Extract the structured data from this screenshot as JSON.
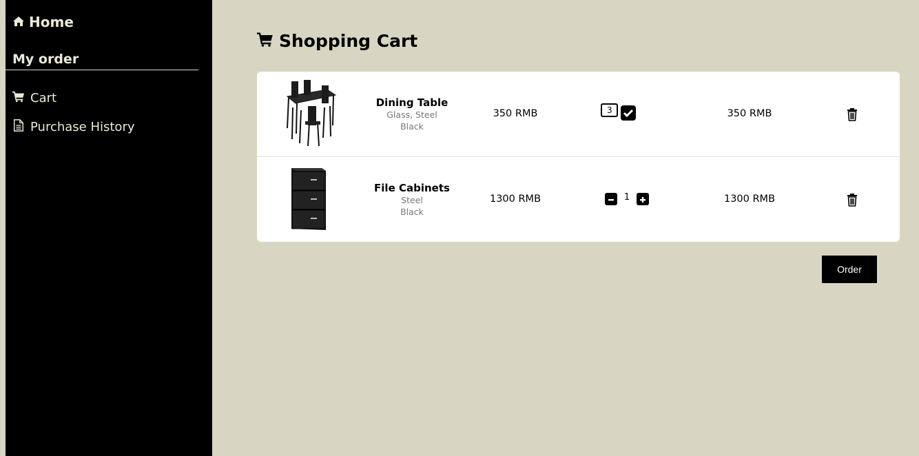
{
  "sidebar": {
    "home_label": "Home",
    "section_label": "My order",
    "items": [
      {
        "label": "Cart",
        "icon": "cart-icon"
      },
      {
        "label": "Purchase History",
        "icon": "document-icon"
      }
    ]
  },
  "main": {
    "title": "Shopping Cart",
    "title_icon": "cart-icon",
    "cart_items": [
      {
        "name": "Dining Table",
        "material": "Glass, Steel",
        "color": "Black",
        "price": "350 RMB",
        "quantity": "3",
        "subtotal": "350 RMB",
        "quantity_mode": "editing"
      },
      {
        "name": "File Cabinets",
        "material": "Steel",
        "color": "Black",
        "price": "1300 RMB",
        "quantity": "1",
        "subtotal": "1300 RMB",
        "quantity_mode": "stepper"
      }
    ],
    "order_button_label": "Order"
  },
  "colors": {
    "background": "#d8d6c2",
    "sidebar": "#000000",
    "sidebar_text": "#ece9d6",
    "card": "#ffffff",
    "button": "#000000"
  }
}
